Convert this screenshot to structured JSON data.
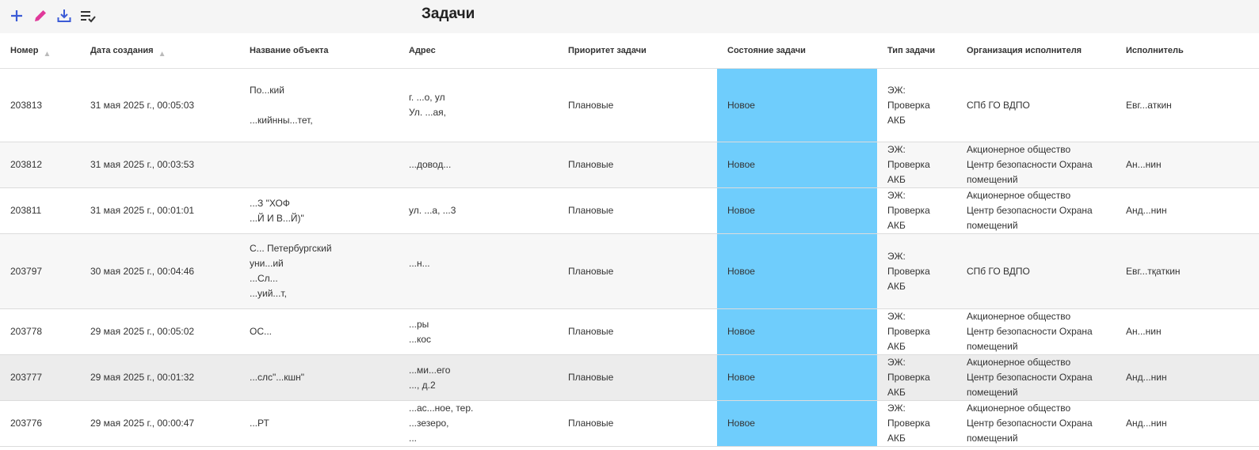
{
  "header": {
    "title": "Задачи"
  },
  "toolbar": {
    "icons": [
      "plus-icon",
      "pencil-icon",
      "download-icon",
      "checklist-icon"
    ],
    "colors": {
      "plus": "#3b5bd6",
      "pencil": "#e0399a",
      "download": "#3b5bd6",
      "checklist": "#333333"
    }
  },
  "table": {
    "columns": [
      "Номер",
      "Дата создания",
      "Название объекта",
      "Адрес",
      "Приоритет задачи",
      "Состояние задачи",
      "Тип задачи",
      "Организация исполнителя",
      "Исполнитель"
    ],
    "state_color": "#6fcdfc",
    "rows": [
      {
        "number": "203813",
        "date": "31 мая 2025 г., 00:05:03",
        "object": [
          "По...кий",
          "",
          "...кийнны...тет,"
        ],
        "address": [
          "г. ...о, ул",
          "Ул. ...ая,"
        ],
        "priority": "Плановые",
        "state": "Новое",
        "type": [
          "ЭЖ:",
          "Проверка",
          "АКБ"
        ],
        "org": [
          "СПб ГО ВДПО"
        ],
        "executor": "Евг...аткин"
      },
      {
        "number": "203812",
        "date": "31 мая 2025 г., 00:03:53",
        "object": [
          ""
        ],
        "address": [
          "...довод..."
        ],
        "priority": "Плановые",
        "state": "Новое",
        "type": [
          "ЭЖ:",
          "Проверка",
          "АКБ"
        ],
        "org": [
          "Акционерное общество",
          "Центр безопасности Охрана",
          "помещений"
        ],
        "executor": "Ан...нин"
      },
      {
        "number": "203811",
        "date": "31 мая 2025 г., 00:01:01",
        "object": [
          "...З \"ХОФ",
          "...Й И В...Й)\""
        ],
        "address": [
          "ул. ...а, ...3"
        ],
        "priority": "Плановые",
        "state": "Новое",
        "type": [
          "ЭЖ:",
          "Проверка",
          "АКБ"
        ],
        "org": [
          "Акционерное общество",
          "Центр безопасности Охрана",
          "помещений"
        ],
        "executor": "Анд...нин"
      },
      {
        "number": "203797",
        "date": "30 мая 2025 г., 00:04:46",
        "object": [
          "С... Петербургский",
          "уни...ий",
          "...Сл...",
          "...уий...т,"
        ],
        "address": [
          "...н...",
          ""
        ],
        "priority": "Плановые",
        "state": "Новое",
        "type": [
          "ЭЖ:",
          "Проверка",
          "АКБ"
        ],
        "org": [
          "СПб ГО ВДПО"
        ],
        "executor": "Евг...тқаткин"
      },
      {
        "number": "203778",
        "date": "29 мая 2025 г., 00:05:02",
        "object": [
          "ОС..."
        ],
        "address": [
          "...ры",
          "...кос"
        ],
        "priority": "Плановые",
        "state": "Новое",
        "type": [
          "ЭЖ:",
          "Проверка",
          "АКБ"
        ],
        "org": [
          "Акционерное общество",
          "Центр безопасности Охрана",
          "помещений"
        ],
        "executor": "Ан...нин"
      },
      {
        "number": "203777",
        "date": "29 мая 2025 г., 00:01:32",
        "object": [
          "...слс\"...кшн\""
        ],
        "address": [
          "...ми...его",
          "..., д.2"
        ],
        "priority": "Плановые",
        "state": "Новое",
        "type": [
          "ЭЖ:",
          "Проверка",
          "АКБ"
        ],
        "org": [
          "Акционерное общество",
          "Центр безопасности Охрана",
          "помещений"
        ],
        "executor": "Анд...нин"
      },
      {
        "number": "203776",
        "date": "29 мая 2025 г., 00:00:47",
        "object": [
          "...РТ"
        ],
        "address": [
          "...ас...ное, тер.",
          "...зезеро,",
          "..."
        ],
        "priority": "Плановые",
        "state": "Новое",
        "type": [
          "ЭЖ:",
          "Проверка",
          "АКБ"
        ],
        "org": [
          "Акционерное общество",
          "Центр безопасности Охрана",
          "помещений"
        ],
        "executor": "Анд...нин"
      }
    ]
  }
}
